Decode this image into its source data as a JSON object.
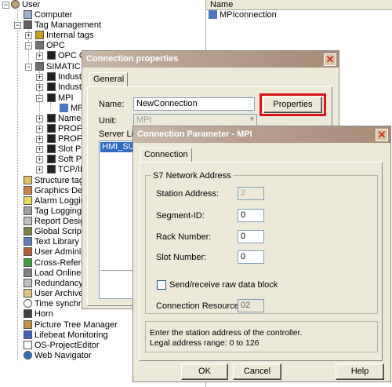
{
  "tree": {
    "items": [
      {
        "label": "User",
        "icon": "user-icon"
      },
      {
        "label": "Computer",
        "icon": "computer-icon"
      },
      {
        "label": "Tag Management",
        "icon": "tag-management-icon"
      },
      {
        "label": "Internal tags",
        "icon": "internal-tags-icon"
      },
      {
        "label": "OPC",
        "icon": "opc-icon"
      },
      {
        "label": "OPC G",
        "icon": "opc-group-icon"
      },
      {
        "label": "SIMATIC S",
        "icon": "simatic-icon"
      },
      {
        "label": "Indust",
        "icon": "industrial-ethernet-icon"
      },
      {
        "label": "Indust",
        "icon": "industrial-ethernet-icon"
      },
      {
        "label": "MPI",
        "icon": "mpi-icon"
      },
      {
        "label": "MP",
        "icon": "mpi-connection-icon"
      },
      {
        "label": "Named",
        "icon": "named-connection-icon"
      },
      {
        "label": "PROFI",
        "icon": "profibus-icon"
      },
      {
        "label": "PROFI",
        "icon": "profibus-icon"
      },
      {
        "label": "Slot PL",
        "icon": "slot-plc-icon"
      },
      {
        "label": "Soft PL",
        "icon": "soft-plc-icon"
      },
      {
        "label": "TCP/IP",
        "icon": "tcpip-icon"
      },
      {
        "label": "Structure tag",
        "icon": "structure-tag-icon"
      },
      {
        "label": "Graphics Desig",
        "icon": "graphics-designer-icon"
      },
      {
        "label": "Alarm Logging",
        "icon": "alarm-logging-icon"
      },
      {
        "label": "Tag Logging",
        "icon": "tag-logging-icon"
      },
      {
        "label": "Report Designe",
        "icon": "report-designer-icon"
      },
      {
        "label": "Global Script",
        "icon": "global-script-icon"
      },
      {
        "label": "Text Library",
        "icon": "text-library-icon"
      },
      {
        "label": "User Administr",
        "icon": "user-administrator-icon"
      },
      {
        "label": "Cross-Referen",
        "icon": "cross-reference-icon"
      },
      {
        "label": "Load Online Ch",
        "icon": "load-online-changes-icon"
      },
      {
        "label": "Redundancy",
        "icon": "redundancy-icon"
      },
      {
        "label": "User Archive",
        "icon": "user-archive-icon"
      },
      {
        "label": "Time synchron",
        "icon": "time-sync-icon"
      },
      {
        "label": "Horn",
        "icon": "horn-icon"
      },
      {
        "label": "Picture Tree Manager",
        "icon": "picture-tree-icon"
      },
      {
        "label": "Lifebeat Monitoring",
        "icon": "lifebeat-icon"
      },
      {
        "label": "OS-ProjectEditor",
        "icon": "os-project-editor-icon"
      },
      {
        "label": "Web Navigator",
        "icon": "web-navigator-icon"
      }
    ]
  },
  "right_pane": {
    "column_header": "Name",
    "items": [
      {
        "label": "MPIconnection",
        "icon": "mpi-connection-icon"
      }
    ]
  },
  "conn_props": {
    "title": "Connection properties",
    "tab": "General",
    "name_label": "Name:",
    "name_value": "NewConnection",
    "properties_button": "Properties",
    "unit_label": "Unit:",
    "unit_value": "MPI",
    "server_list_label": "Server List",
    "server_list_item": "HMI_SUN"
  },
  "conn_param": {
    "title": "Connection Parameter - MPI",
    "tab": "Connection",
    "group_title": "S7 Network Address",
    "station_label": "Station Address:",
    "station_value": "2",
    "segment_label": "Segment-ID:",
    "segment_value": "0",
    "rack_label": "Rack Number:",
    "rack_value": "0",
    "slot_label": "Slot Number:",
    "slot_value": "0",
    "raw_checkbox_label": "Send/receive raw data block",
    "resource_label": "Connection Resource:",
    "resource_value": "02",
    "hint_line1": "Enter the station address of the controller.",
    "hint_line2": "Legal address range: 0 to 126",
    "ok": "OK",
    "cancel": "Cancel",
    "help": "Help"
  },
  "colors": {
    "highlight": "#d8141c",
    "title_gradient_start": "#c8b8a8",
    "title_gradient_end": "#a68c78"
  }
}
